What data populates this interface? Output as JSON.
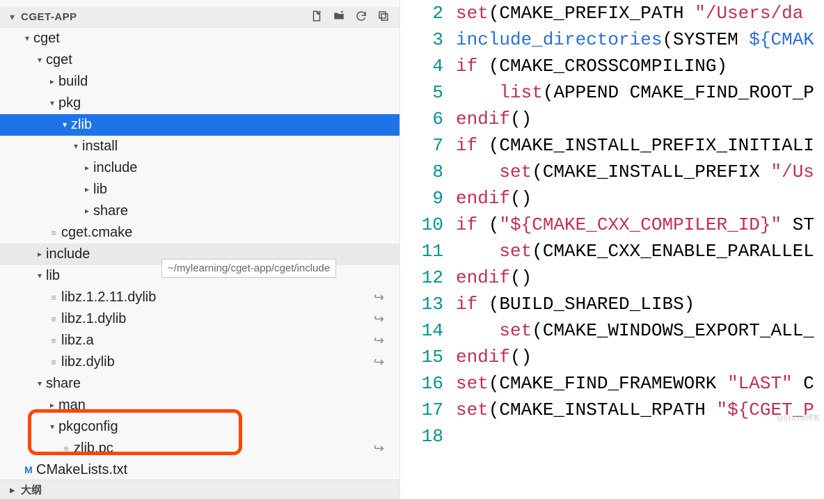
{
  "project": {
    "name": "CGET-APP",
    "outline_label": "大纲"
  },
  "tooltip": "~/mylearning/cget-app/cget/include",
  "header_icons": [
    "new-file-icon",
    "new-folder-icon",
    "refresh-icon",
    "collapse-all-icon"
  ],
  "tree": {
    "cget_root": "cget",
    "cget": "cget",
    "build": "build",
    "pkg": "pkg",
    "zlib": "zlib",
    "install": "install",
    "include": "include",
    "lib": "lib",
    "share": "share",
    "cget_cmake": "cget.cmake",
    "root_include": "include",
    "root_lib": "lib",
    "libz_1211": "libz.1.2.11.dylib",
    "libz_1": "libz.1.dylib",
    "libz_a": "libz.a",
    "libz_dylib": "libz.dylib",
    "root_share": "share",
    "man": "man",
    "pkgconfig": "pkgconfig",
    "zlib_pc": "zlib.pc",
    "cmakelists": "CMakeLists.txt"
  },
  "code": {
    "lines": [
      {
        "n": 2,
        "html": "<span class='kw'>set</span>(CMAKE_PREFIX_PATH <span class='str'>\"/Users/da</span>"
      },
      {
        "n": 3,
        "html": "<span class='var'>include_directories</span>(SYSTEM <span class='var'>${CMAK</span>"
      },
      {
        "n": 4,
        "html": "<span class='kw'>if</span> (CMAKE_CROSSCOMPILING)"
      },
      {
        "n": 5,
        "html": "    <span class='kw'>list</span>(APPEND CMAKE_FIND_ROOT_P"
      },
      {
        "n": 6,
        "html": "<span class='kw'>endif</span>()"
      },
      {
        "n": 7,
        "html": "<span class='kw'>if</span> (CMAKE_INSTALL_PREFIX_INITIALI"
      },
      {
        "n": 8,
        "html": "    <span class='kw'>set</span>(CMAKE_INSTALL_PREFIX <span class='str'>\"/Us</span>"
      },
      {
        "n": 9,
        "html": "<span class='kw'>endif</span>()"
      },
      {
        "n": 10,
        "html": "<span class='kw'>if</span> (<span class='str'>\"${CMAKE_CXX_COMPILER_ID}\"</span> ST"
      },
      {
        "n": 11,
        "html": "    <span class='kw'>set</span>(CMAKE_CXX_ENABLE_PARALLEL"
      },
      {
        "n": 12,
        "html": "<span class='kw'>endif</span>()"
      },
      {
        "n": 13,
        "html": "<span class='kw'>if</span> (BUILD_SHARED_LIBS)"
      },
      {
        "n": 14,
        "html": "    <span class='kw'>set</span>(CMAKE_WINDOWS_EXPORT_ALL_"
      },
      {
        "n": 15,
        "html": "<span class='kw'>endif</span>()"
      },
      {
        "n": 16,
        "html": "<span class='kw'>set</span>(CMAKE_FIND_FRAMEWORK <span class='str'>\"LAST\"</span> C"
      },
      {
        "n": 17,
        "html": "<span class='kw'>set</span>(CMAKE_INSTALL_RPATH <span class='str'>\"${CGET_P</span>"
      },
      {
        "n": 18,
        "html": ""
      }
    ]
  }
}
